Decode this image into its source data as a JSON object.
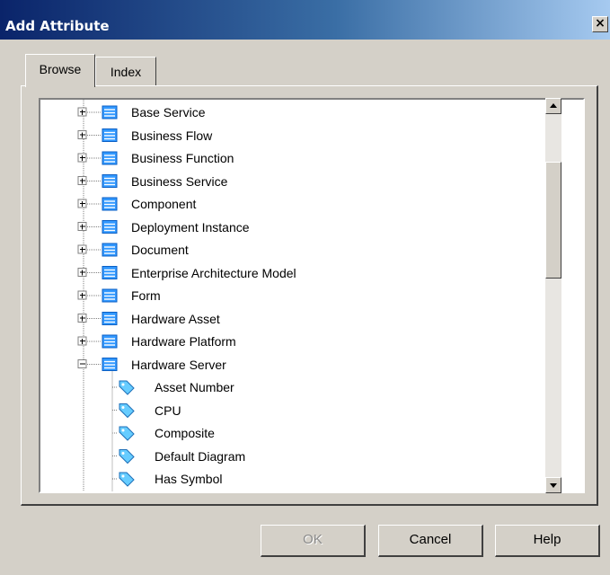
{
  "window": {
    "title": "Add Attribute",
    "close_label": "×"
  },
  "tabs": [
    {
      "label": "Browse",
      "active": true
    },
    {
      "label": "Index",
      "active": false
    }
  ],
  "tree": {
    "items": [
      {
        "label": "Base Service",
        "level": 1,
        "expander": "plus",
        "icon": "class-icon"
      },
      {
        "label": "Business Flow",
        "level": 1,
        "expander": "plus",
        "icon": "class-icon"
      },
      {
        "label": "Business Function",
        "level": 1,
        "expander": "plus",
        "icon": "class-icon"
      },
      {
        "label": "Business Service",
        "level": 1,
        "expander": "plus",
        "icon": "class-icon"
      },
      {
        "label": "Component",
        "level": 1,
        "expander": "plus",
        "icon": "class-icon"
      },
      {
        "label": "Deployment Instance",
        "level": 1,
        "expander": "plus",
        "icon": "class-icon"
      },
      {
        "label": "Document",
        "level": 1,
        "expander": "plus",
        "icon": "class-icon"
      },
      {
        "label": "Enterprise Architecture Model",
        "level": 1,
        "expander": "plus",
        "icon": "class-icon"
      },
      {
        "label": "Form",
        "level": 1,
        "expander": "plus",
        "icon": "class-icon"
      },
      {
        "label": "Hardware Asset",
        "level": 1,
        "expander": "plus",
        "icon": "class-icon"
      },
      {
        "label": "Hardware Platform",
        "level": 1,
        "expander": "plus",
        "icon": "class-icon"
      },
      {
        "label": "Hardware Server",
        "level": 1,
        "expander": "minus",
        "icon": "class-icon"
      },
      {
        "label": "Asset Number",
        "level": 2,
        "expander": "none",
        "icon": "attribute-icon"
      },
      {
        "label": "CPU",
        "level": 2,
        "expander": "none",
        "icon": "attribute-icon"
      },
      {
        "label": "Composite",
        "level": 2,
        "expander": "none",
        "icon": "attribute-icon"
      },
      {
        "label": "Default Diagram",
        "level": 2,
        "expander": "none",
        "icon": "attribute-icon"
      },
      {
        "label": "Has Symbol",
        "level": 2,
        "expander": "none",
        "icon": "attribute-icon"
      }
    ]
  },
  "scrollbar": {
    "up_icon": "scroll-up-arrow-icon",
    "down_icon": "scroll-down-arrow-icon"
  },
  "buttons": {
    "ok": "OK",
    "cancel": "Cancel",
    "help": "Help"
  },
  "colors": {
    "title_start": "#0a246a",
    "title_end": "#a6caf0",
    "dialog_bg": "#d4d0c8",
    "class_icon": "#3399ff",
    "attribute_icon": "#66ccff"
  }
}
